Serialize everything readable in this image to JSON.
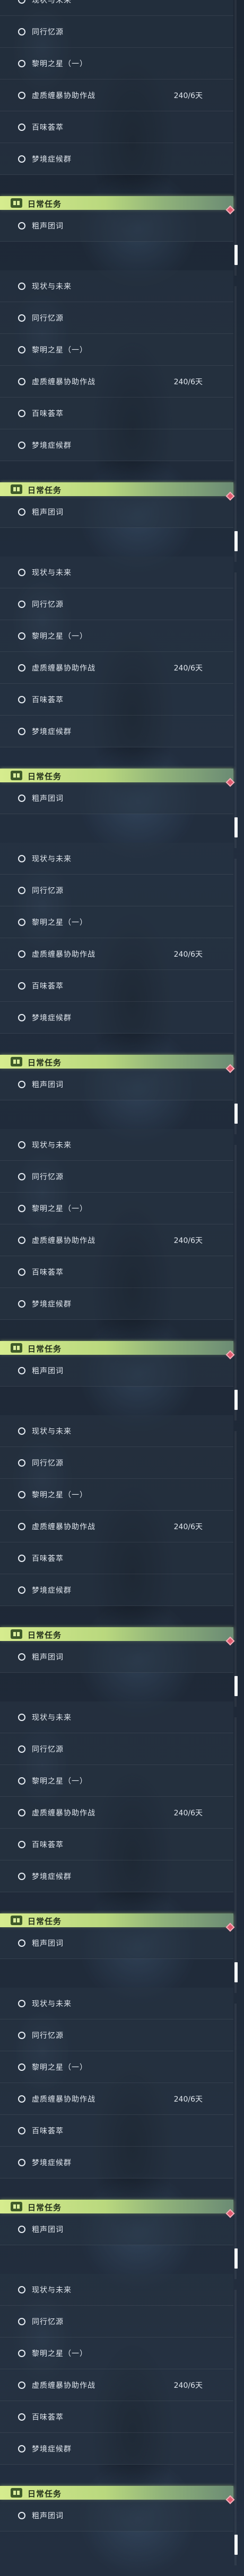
{
  "theme": {
    "accent": "#c8e388",
    "gem": "#e05a6e"
  },
  "panels": [
    {
      "items": [
        {
          "label": "现状与未来",
          "value": ""
        },
        {
          "label": "同行忆源",
          "value": ""
        },
        {
          "label": "黎明之星（一）",
          "value": ""
        },
        {
          "label": "虚质缠暴协助作战",
          "value": "240/6天"
        },
        {
          "label": "百味荟萃",
          "value": ""
        },
        {
          "label": "梦境症候群",
          "value": ""
        }
      ],
      "daily": {
        "label": "日常任务",
        "icon": "calendar-icon"
      },
      "after": {
        "label": "粗声团词"
      }
    },
    {
      "items": [
        {
          "label": "现状与未来",
          "value": ""
        },
        {
          "label": "同行忆源",
          "value": ""
        },
        {
          "label": "黎明之星（一）",
          "value": ""
        },
        {
          "label": "虚质缠暴协助作战",
          "value": "240/6天"
        },
        {
          "label": "百味荟萃",
          "value": ""
        },
        {
          "label": "梦境症候群",
          "value": ""
        }
      ],
      "daily": {
        "label": "日常任务",
        "icon": "calendar-icon"
      },
      "after": {
        "label": "粗声团词"
      }
    },
    {
      "items": [
        {
          "label": "现状与未来",
          "value": ""
        },
        {
          "label": "同行忆源",
          "value": ""
        },
        {
          "label": "黎明之星（一）",
          "value": ""
        },
        {
          "label": "虚质缠暴协助作战",
          "value": "240/6天"
        },
        {
          "label": "百味荟萃",
          "value": ""
        },
        {
          "label": "梦境症候群",
          "value": ""
        }
      ],
      "daily": {
        "label": "日常任务",
        "icon": "calendar-icon"
      },
      "after": {
        "label": "粗声团词"
      }
    },
    {
      "items": [
        {
          "label": "现状与未来",
          "value": ""
        },
        {
          "label": "同行忆源",
          "value": ""
        },
        {
          "label": "黎明之星（一）",
          "value": ""
        },
        {
          "label": "虚质缠暴协助作战",
          "value": "240/6天"
        },
        {
          "label": "百味荟萃",
          "value": ""
        },
        {
          "label": "梦境症候群",
          "value": ""
        }
      ],
      "daily": {
        "label": "日常任务",
        "icon": "calendar-icon"
      },
      "after": {
        "label": "粗声团词"
      }
    },
    {
      "items": [
        {
          "label": "现状与未来",
          "value": ""
        },
        {
          "label": "同行忆源",
          "value": ""
        },
        {
          "label": "黎明之星（一）",
          "value": ""
        },
        {
          "label": "虚质缠暴协助作战",
          "value": "240/6天"
        },
        {
          "label": "百味荟萃",
          "value": ""
        },
        {
          "label": "梦境症候群",
          "value": ""
        }
      ],
      "daily": {
        "label": "日常任务",
        "icon": "calendar-icon"
      },
      "after": {
        "label": "粗声团词"
      }
    },
    {
      "items": [
        {
          "label": "现状与未来",
          "value": ""
        },
        {
          "label": "同行忆源",
          "value": ""
        },
        {
          "label": "黎明之星（一）",
          "value": ""
        },
        {
          "label": "虚质缠暴协助作战",
          "value": "240/6天"
        },
        {
          "label": "百味荟萃",
          "value": ""
        },
        {
          "label": "梦境症候群",
          "value": ""
        }
      ],
      "daily": {
        "label": "日常任务",
        "icon": "calendar-icon"
      },
      "after": {
        "label": "粗声团词"
      }
    },
    {
      "items": [
        {
          "label": "现状与未来",
          "value": ""
        },
        {
          "label": "同行忆源",
          "value": ""
        },
        {
          "label": "黎明之星（一）",
          "value": ""
        },
        {
          "label": "虚质缠暴协助作战",
          "value": "240/6天"
        },
        {
          "label": "百味荟萃",
          "value": ""
        },
        {
          "label": "梦境症候群",
          "value": ""
        }
      ],
      "daily": {
        "label": "日常任务",
        "icon": "calendar-icon"
      },
      "after": {
        "label": "粗声团词"
      }
    },
    {
      "items": [
        {
          "label": "现状与未来",
          "value": ""
        },
        {
          "label": "同行忆源",
          "value": ""
        },
        {
          "label": "黎明之星（一）",
          "value": ""
        },
        {
          "label": "虚质缠暴协助作战",
          "value": "240/6天"
        },
        {
          "label": "百味荟萃",
          "value": ""
        },
        {
          "label": "梦境症候群",
          "value": ""
        }
      ],
      "daily": {
        "label": "日常任务",
        "icon": "calendar-icon"
      },
      "after": {
        "label": "粗声团词"
      }
    },
    {
      "items": [
        {
          "label": "现状与未来",
          "value": ""
        },
        {
          "label": "同行忆源",
          "value": ""
        },
        {
          "label": "黎明之星（一）",
          "value": ""
        },
        {
          "label": "虚质缠暴协助作战",
          "value": "240/6天"
        },
        {
          "label": "百味荟萃",
          "value": ""
        },
        {
          "label": "梦境症候群",
          "value": ""
        }
      ],
      "daily": {
        "label": "日常任务",
        "icon": "calendar-icon"
      },
      "after": {
        "label": "粗声团词"
      }
    }
  ]
}
